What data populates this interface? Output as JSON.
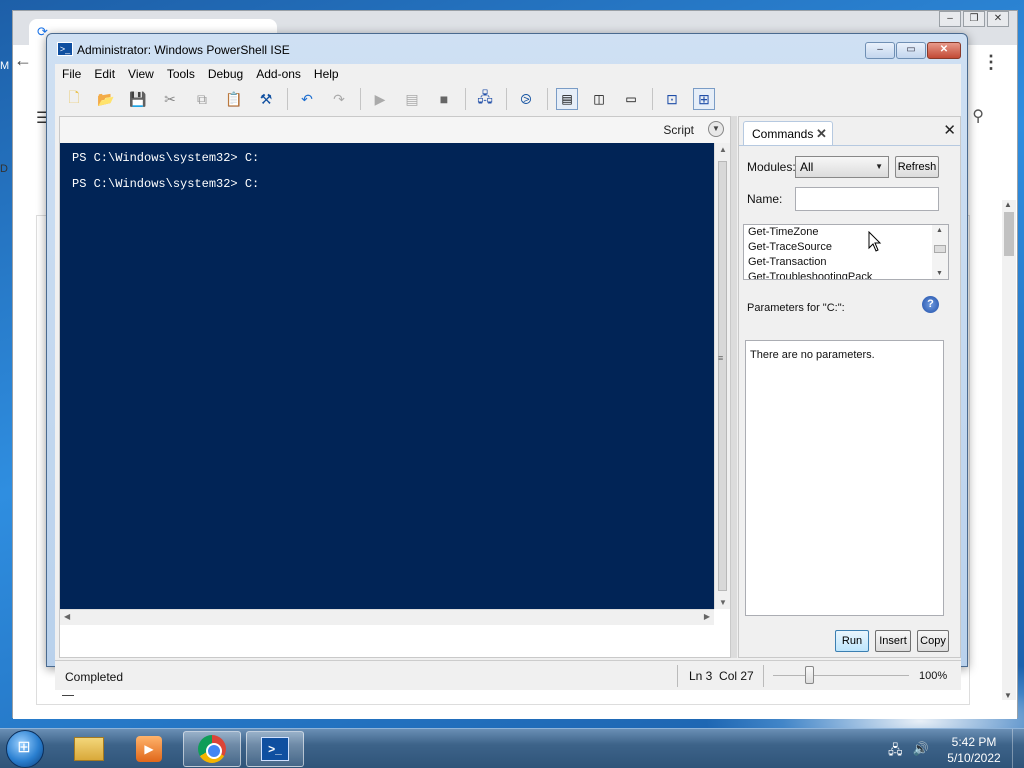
{
  "window": {
    "title": "Administrator: Windows PowerShell ISE",
    "menu": [
      "File",
      "Edit",
      "View",
      "Tools",
      "Debug",
      "Add-ons",
      "Help"
    ]
  },
  "toolbar": {
    "icons": [
      "new-file",
      "open-file",
      "save",
      "cut",
      "copy",
      "paste",
      "clear-console",
      "undo",
      "redo",
      "run-script",
      "run-selection",
      "stop",
      "new-remote-tab",
      "start-powershell",
      "show-script-top",
      "show-script-right",
      "show-script-max",
      "show-command-window",
      "show-command-addon"
    ]
  },
  "script_pane": {
    "label": "Script"
  },
  "console": {
    "lines": [
      "PS C:\\Windows\\system32> C:",
      "PS C:\\Windows\\system32> C:"
    ]
  },
  "commands": {
    "tab_label": "Commands",
    "modules_label": "Modules:",
    "modules_value": "All",
    "refresh_label": "Refresh",
    "name_label": "Name:",
    "name_value": "",
    "list": [
      "Get-TimeZone",
      "Get-TraceSource",
      "Get-Transaction",
      "Get-TroubleshootingPack"
    ],
    "params_label": "Parameters for \"C:\":",
    "params_empty": "There are no parameters.",
    "run_label": "Run",
    "insert_label": "Insert",
    "copy_label": "Copy"
  },
  "status": {
    "text": "Completed",
    "position": "Ln 3  Col 27",
    "zoom": "100%",
    "zoom_level": 0.25
  },
  "taskbar": {
    "apps": [
      "windows-explorer",
      "windows-media-player",
      "google-chrome",
      "windows-powershell"
    ],
    "active_app": "windows-powershell",
    "time": "5:42 PM",
    "date": "5/10/2022"
  },
  "background": {
    "left_edge_letters": [
      "M",
      "D"
    ]
  },
  "colors": {
    "console_bg": "#012456",
    "console_fg": "#ffffff",
    "title_bar": "#cfe0f3"
  }
}
